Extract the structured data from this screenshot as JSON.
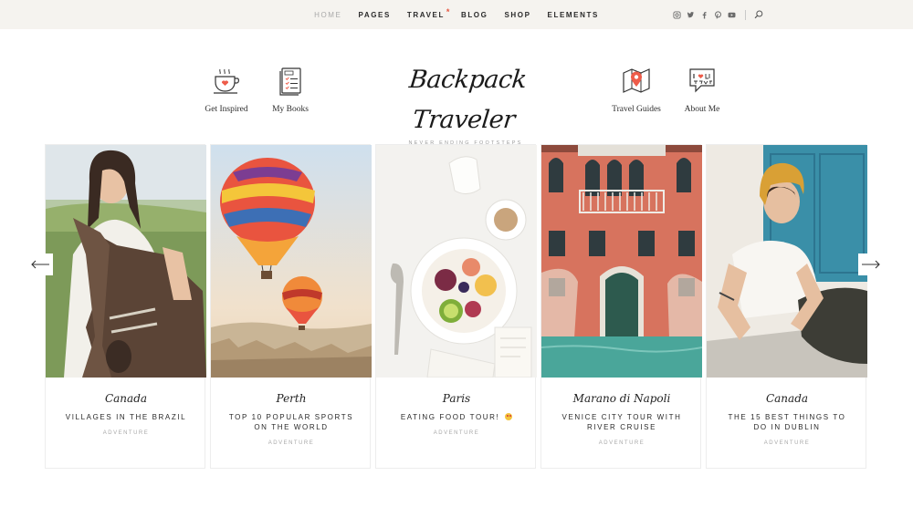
{
  "nav": {
    "items": [
      {
        "label": "Home",
        "active": true
      },
      {
        "label": "Pages",
        "active": false
      },
      {
        "label": "Travel",
        "active": false,
        "badge": "*"
      },
      {
        "label": "Blog",
        "active": false
      },
      {
        "label": "Shop",
        "active": false
      },
      {
        "label": "Elements",
        "active": false
      }
    ],
    "social": [
      "instagram-icon",
      "twitter-icon",
      "facebook-icon",
      "pinterest-icon",
      "youtube-icon"
    ],
    "search_icon": "search-icon"
  },
  "header": {
    "links_left": [
      {
        "label": "Get Inspired",
        "icon": "coffee-cup-icon"
      },
      {
        "label": "My Books",
        "icon": "notebook-icon"
      }
    ],
    "links_right": [
      {
        "label": "Travel Guides",
        "icon": "map-icon"
      },
      {
        "label": "About Me",
        "icon": "i-love-travel-icon"
      }
    ],
    "logo": "Backpack Traveler",
    "tagline": "Never Ending Footsteps"
  },
  "slider": {
    "cards": [
      {
        "location": "Canada",
        "title": "Villages in the Brazil",
        "tag": "Adventure"
      },
      {
        "location": "Perth",
        "title": "Top 10 Popular Sports on the World",
        "tag": "Adventure"
      },
      {
        "location": "Paris",
        "title": "Eating Food Tour!",
        "tag": "Adventure"
      },
      {
        "location": "Marano di Napoli",
        "title": "Venice City Tour with River Cruise",
        "tag": "Adventure"
      },
      {
        "location": "Canada",
        "title": "The 15 Best Things to Do in Dublin",
        "tag": "Adventure"
      }
    ],
    "prev_icon": "arrow-left-icon",
    "next_icon": "arrow-right-icon"
  },
  "colors": {
    "topbar_bg": "#f5f3ef",
    "accent": "#e6553f",
    "muted": "#a8a8a8"
  }
}
